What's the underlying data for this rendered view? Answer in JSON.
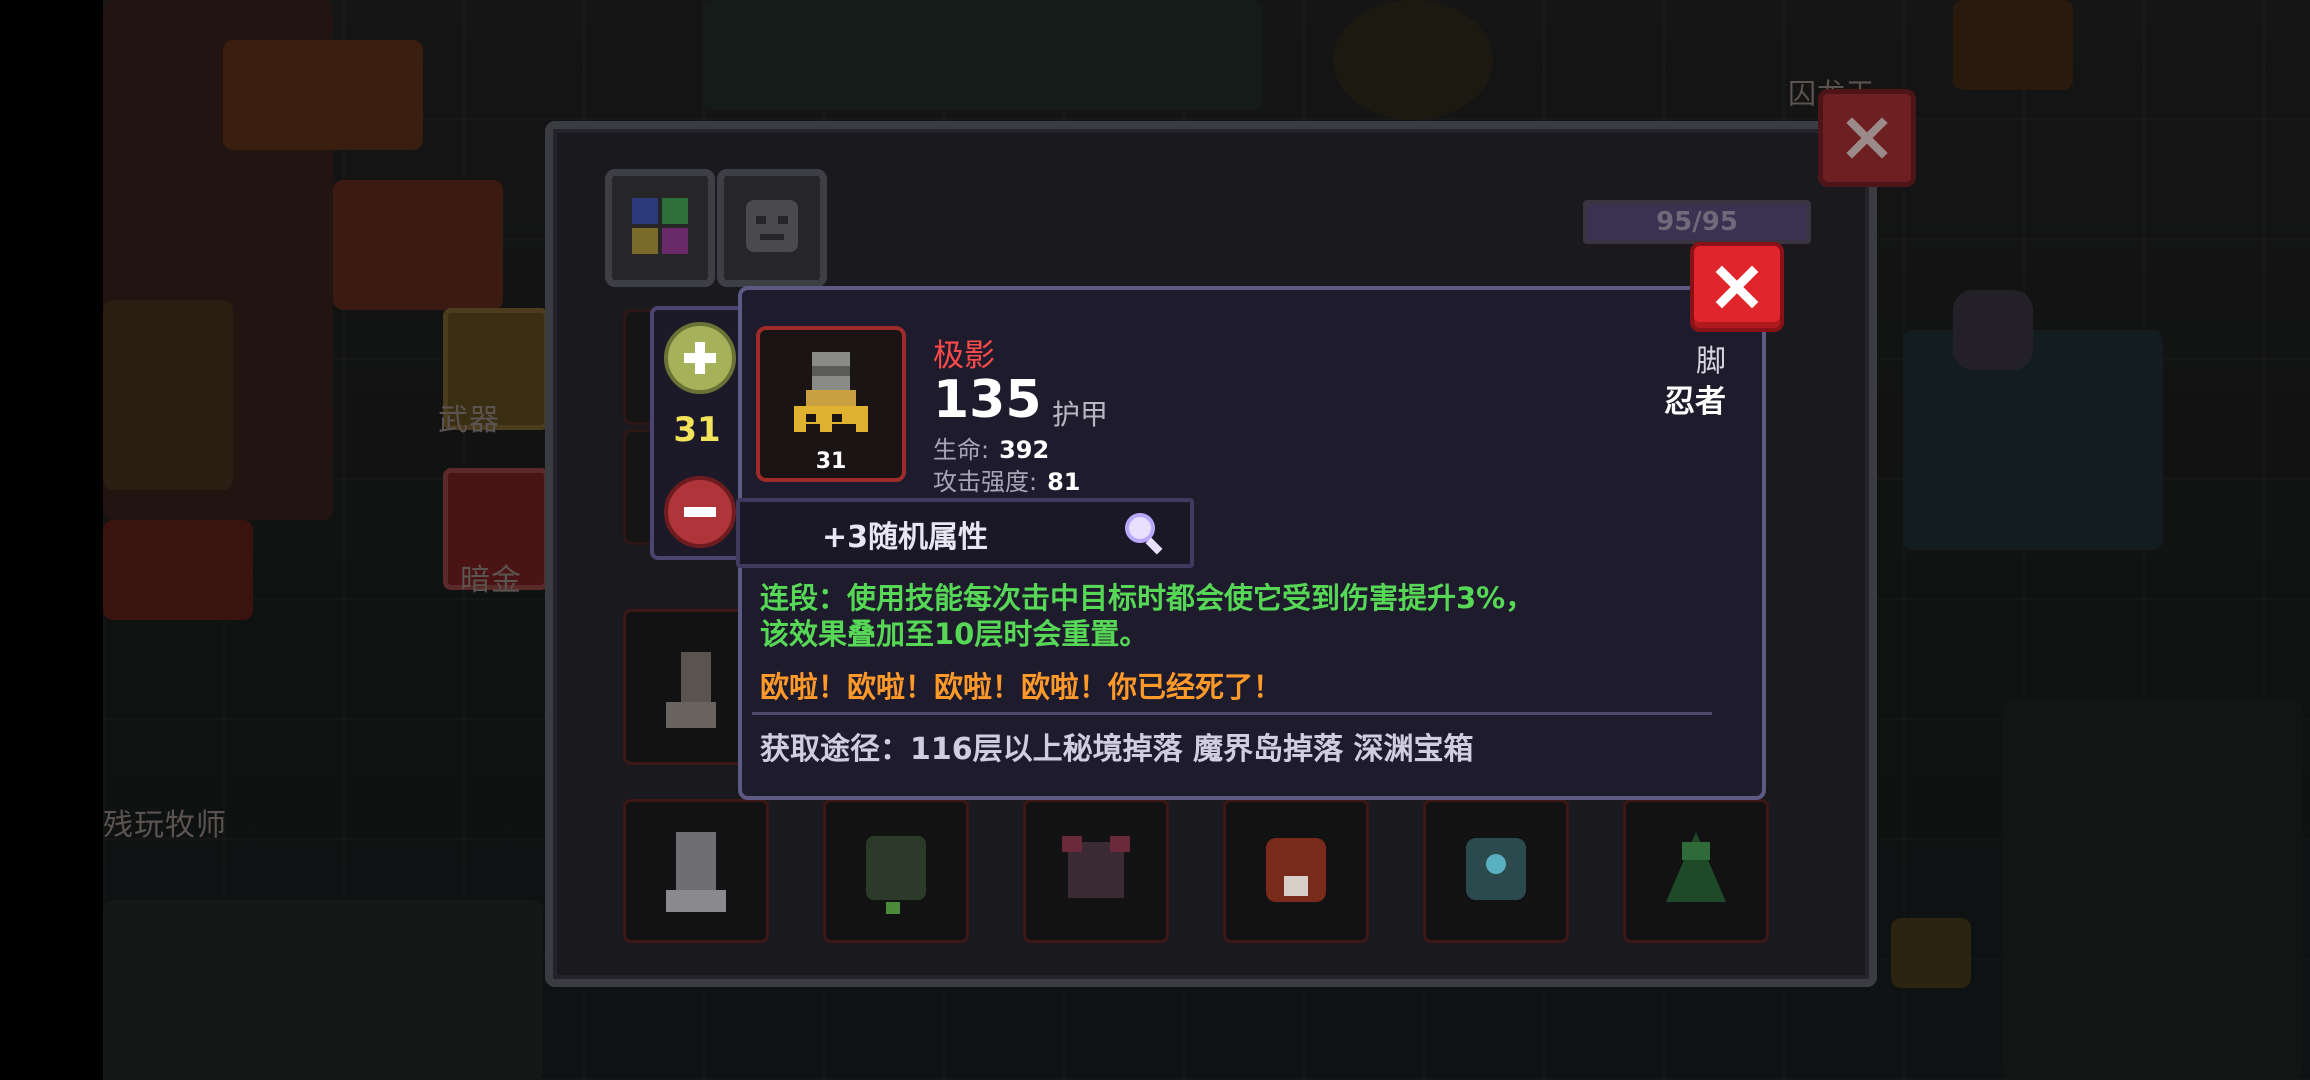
{
  "background": {
    "labels": {
      "weapon": "武器",
      "dark_gold": "暗金",
      "player_name": "残玩牧师",
      "top_npc": "囚龙王"
    }
  },
  "panel": {
    "hp": {
      "text": "95/95",
      "fraction": 1.0
    }
  },
  "stepper": {
    "value": "31"
  },
  "item": {
    "name": "极影",
    "armor_value": "135",
    "armor_label": "护甲",
    "level": "31",
    "stats": [
      {
        "label": "生命:",
        "value": "392"
      },
      {
        "label": "攻击强度:",
        "value": "81"
      }
    ],
    "slot_type": "脚",
    "class_type": "忍者",
    "random_attr": "+3随机属性",
    "effect_line1": "连段：使用技能每次击中目标时都会使它受到伤害提升3%，",
    "effect_line2": "该效果叠加至10层时会重置。",
    "flavor": "欧啦！欧啦！欧啦！欧啦！你已经死了！",
    "source": "获取途径：116层以上秘境掉落 魔界岛掉落 深渊宝箱"
  },
  "colors": {
    "item_name": "#ff4a4a",
    "effect": "#56d856",
    "flavor": "#ff9a2a",
    "level": "#f2e35a",
    "close_red": "#e0262c"
  },
  "icons": {
    "close": "close-icon",
    "plus": "plus-icon",
    "minus": "minus-icon",
    "magnify": "magnify-icon",
    "item": "ninja-boots-icon"
  }
}
